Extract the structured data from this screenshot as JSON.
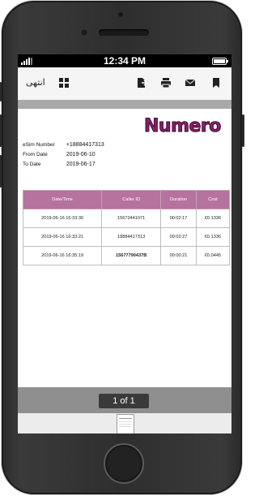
{
  "status": {
    "time": "12:34 PM"
  },
  "toolbar": {
    "done_label": "انتهى",
    "icons": [
      "grid-icon",
      "export-icon",
      "print-icon",
      "mail-icon",
      "bookmark-icon"
    ]
  },
  "document": {
    "logo_text": "Numero",
    "info": [
      {
        "label": "eSim Number",
        "value": "+18884417313"
      },
      {
        "label": "From Date",
        "value": "2019-06-10"
      },
      {
        "label": "To Date",
        "value": "2019-06-17"
      }
    ],
    "table": {
      "headers": [
        "Date/Time",
        "Caller ID",
        "Duration",
        "Cost"
      ],
      "rows": [
        [
          "2019-06-16 16:33:30",
          "15672441071",
          "00:02:17",
          "€0.1336"
        ],
        [
          "2019-06-16 16:33:21",
          "18884417313",
          "00:02:27",
          "€0.1336"
        ],
        [
          "2019-06-16 16:35:19",
          "15677790437B",
          "00:00:21",
          "€0.0445"
        ]
      ]
    }
  },
  "pager": {
    "label": "1 of 1"
  },
  "colors": {
    "accent": "#b5739d",
    "logo": "#8b1e6b"
  }
}
